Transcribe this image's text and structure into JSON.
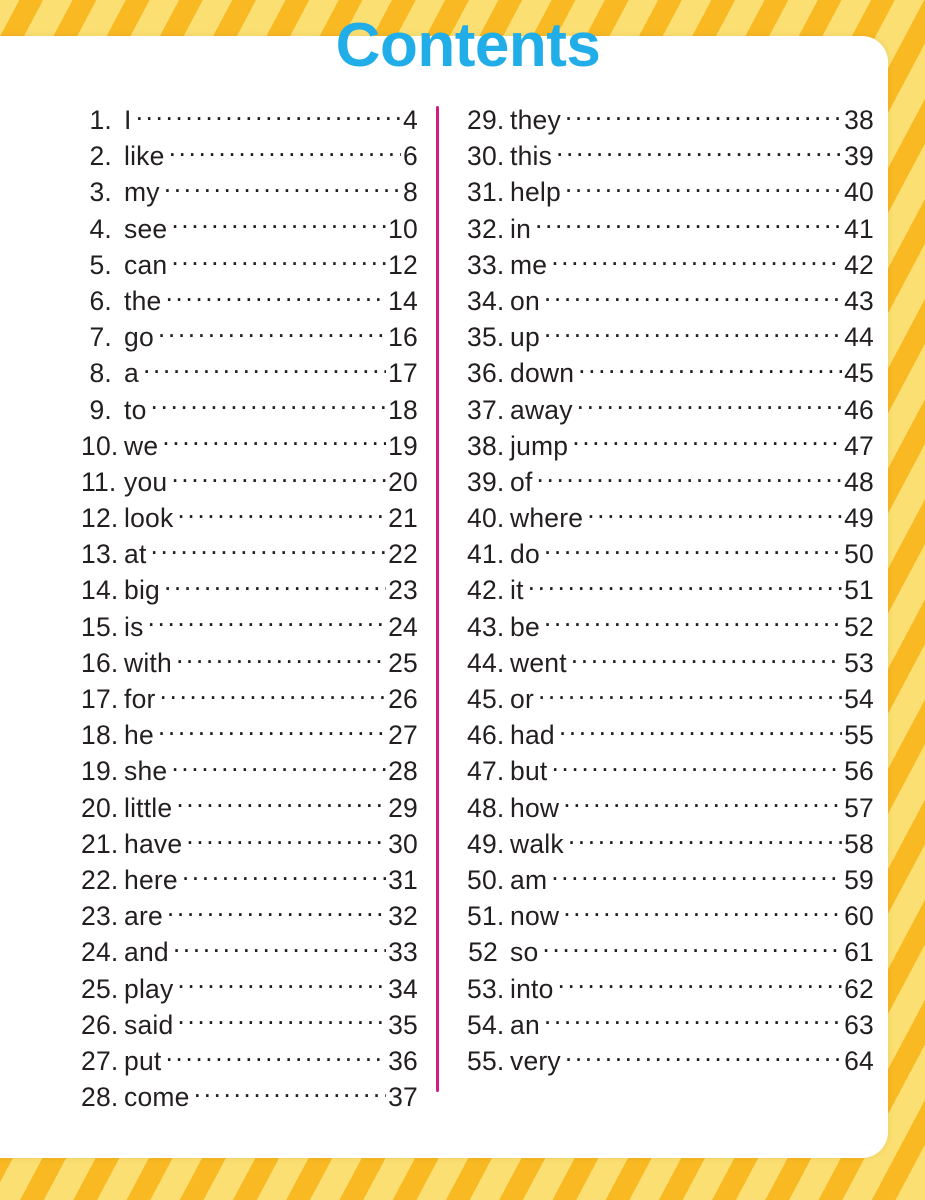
{
  "page": {
    "title": "Contents",
    "title_color": "#21AEE8",
    "divider_color": "#CE2084",
    "border_stripe_light": "#FBDF72",
    "border_stripe_dark": "#F8B923",
    "paper_color": "#FFFFFF",
    "text_color": "#231F20"
  },
  "toc": {
    "left_column": [
      {
        "number": "1.",
        "word": "I",
        "page": "4"
      },
      {
        "number": "2.",
        "word": "like",
        "page": "6"
      },
      {
        "number": "3.",
        "word": "my",
        "page": "8"
      },
      {
        "number": "4.",
        "word": "see",
        "page": "10"
      },
      {
        "number": "5.",
        "word": "can",
        "page": "12"
      },
      {
        "number": "6.",
        "word": "the",
        "page": "14"
      },
      {
        "number": "7.",
        "word": "go",
        "page": "16"
      },
      {
        "number": "8.",
        "word": "a",
        "page": "17"
      },
      {
        "number": "9.",
        "word": "to",
        "page": "18"
      },
      {
        "number": "10.",
        "word": "we",
        "page": "19"
      },
      {
        "number": "11.",
        "word": "you",
        "page": "20"
      },
      {
        "number": "12.",
        "word": "look",
        "page": "21"
      },
      {
        "number": "13.",
        "word": "at",
        "page": "22"
      },
      {
        "number": "14.",
        "word": "big",
        "page": "23"
      },
      {
        "number": "15.",
        "word": "is",
        "page": "24"
      },
      {
        "number": "16.",
        "word": "with",
        "page": "25"
      },
      {
        "number": "17.",
        "word": "for",
        "page": "26"
      },
      {
        "number": "18.",
        "word": "he",
        "page": "27"
      },
      {
        "number": "19.",
        "word": "she",
        "page": "28"
      },
      {
        "number": "20.",
        "word": "little",
        "page": "29"
      },
      {
        "number": "21.",
        "word": "have",
        "page": "30"
      },
      {
        "number": "22.",
        "word": "here",
        "page": "31"
      },
      {
        "number": "23.",
        "word": "are",
        "page": "32"
      },
      {
        "number": "24.",
        "word": "and",
        "page": "33"
      },
      {
        "number": "25.",
        "word": "play",
        "page": "34"
      },
      {
        "number": "26.",
        "word": "said",
        "page": "35"
      },
      {
        "number": "27.",
        "word": "put",
        "page": "36"
      },
      {
        "number": "28.",
        "word": "come",
        "page": "37"
      }
    ],
    "right_column": [
      {
        "number": "29.",
        "word": "they",
        "page": "38"
      },
      {
        "number": "30.",
        "word": "this",
        "page": "39"
      },
      {
        "number": "31.",
        "word": "help",
        "page": "40"
      },
      {
        "number": "32.",
        "word": "in",
        "page": "41"
      },
      {
        "number": "33.",
        "word": "me",
        "page": "42"
      },
      {
        "number": "34.",
        "word": "on",
        "page": "43"
      },
      {
        "number": "35.",
        "word": "up",
        "page": "44"
      },
      {
        "number": "36.",
        "word": "down",
        "page": "45"
      },
      {
        "number": "37.",
        "word": "away",
        "page": "46"
      },
      {
        "number": "38.",
        "word": "jump",
        "page": "47"
      },
      {
        "number": "39.",
        "word": "of",
        "page": "48"
      },
      {
        "number": "40.",
        "word": "where",
        "page": "49"
      },
      {
        "number": "41.",
        "word": "do",
        "page": "50"
      },
      {
        "number": "42.",
        "word": "it",
        "page": "51"
      },
      {
        "number": "43.",
        "word": "be",
        "page": "52"
      },
      {
        "number": "44.",
        "word": "went",
        "page": "53"
      },
      {
        "number": "45.",
        "word": "or",
        "page": "54"
      },
      {
        "number": "46.",
        "word": "had",
        "page": "55"
      },
      {
        "number": "47.",
        "word": "but",
        "page": "56"
      },
      {
        "number": "48.",
        "word": "how",
        "page": "57"
      },
      {
        "number": "49.",
        "word": "walk",
        "page": "58"
      },
      {
        "number": "50.",
        "word": "am",
        "page": "59"
      },
      {
        "number": "51.",
        "word": "now",
        "page": "60"
      },
      {
        "number": "52",
        "word": "so",
        "page": "61"
      },
      {
        "number": "53.",
        "word": "into",
        "page": "62"
      },
      {
        "number": "54.",
        "word": "an",
        "page": "63"
      },
      {
        "number": "55.",
        "word": "very",
        "page": "64"
      }
    ]
  }
}
